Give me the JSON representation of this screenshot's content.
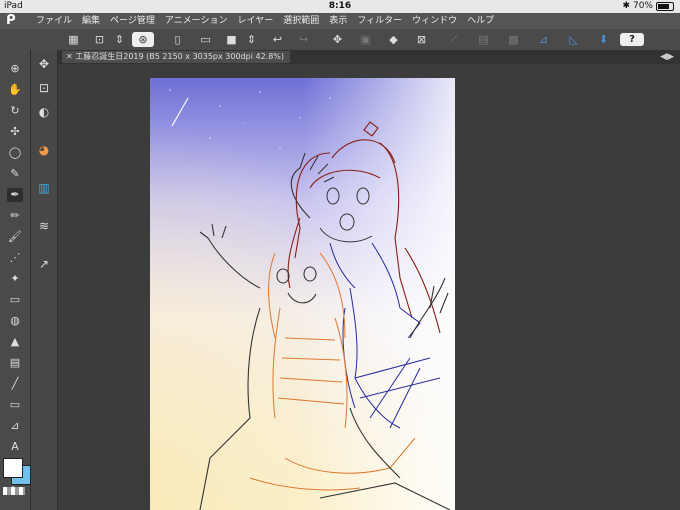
{
  "status_bar": {
    "device": "iPad",
    "time": "8:16",
    "battery": "70%"
  },
  "menu": {
    "items": [
      "ファイル",
      "編集",
      "ページ管理",
      "アニメーション",
      "レイヤー",
      "選択範囲",
      "表示",
      "フィルター",
      "ウィンドウ",
      "ヘルプ"
    ]
  },
  "document": {
    "tab_title": "工藤忍誕生日2019 (B5 2150 x 3035px 300dpi 42.8%)"
  },
  "toolbar": {
    "help_label": "?"
  },
  "colors": {
    "sky_top": "#6f6fd6",
    "sky_mid": "#c7c3f0",
    "warm_bottom": "#fcf3d2",
    "sketch_red": "#8a1d12",
    "sketch_blue": "#262aa0",
    "sketch_orange": "#e0782e",
    "main_color": "#ffffff",
    "sub_color": "#6fc0ec"
  },
  "icons": {
    "left_tools": [
      "zoom-icon",
      "hand-icon",
      "rotate-icon",
      "move-icon",
      "lasso-icon",
      "eyedropper-icon",
      "pen-icon",
      "pencil-icon",
      "brush-icon",
      "airbrush-icon",
      "decoration-icon",
      "eraser-icon",
      "blend-icon",
      "fill-icon",
      "gradient-icon",
      "line-icon",
      "frame-icon",
      "ruler-icon",
      "text-icon",
      "balloon-icon",
      "correct-line-icon"
    ],
    "sub_tools": [
      "layer-move-icon",
      "select-layer-icon",
      "tone-icon",
      "color-wheel-icon",
      "color-slider-icon",
      "layers-icon",
      "navigator-icon"
    ]
  }
}
